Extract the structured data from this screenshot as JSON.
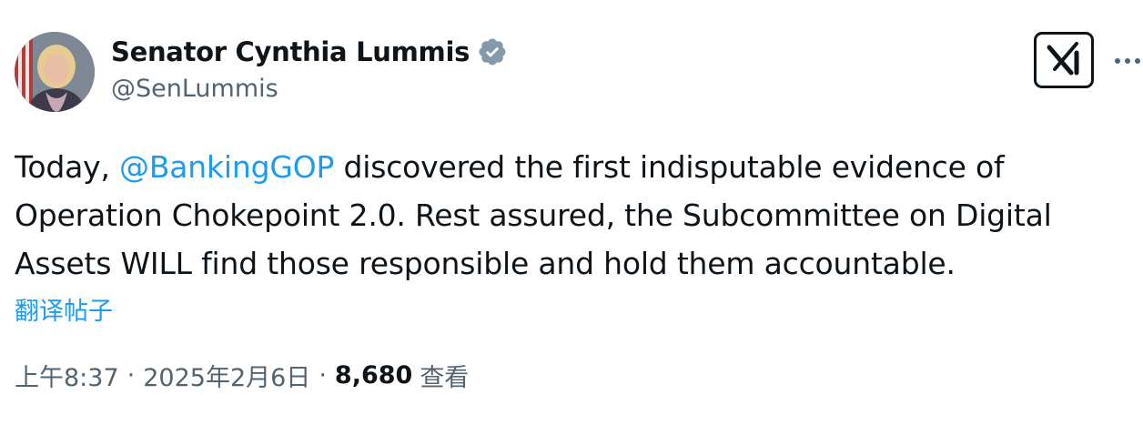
{
  "author": {
    "display_name": "Senator Cynthia Lummis",
    "handle": "@SenLummis",
    "verified_icon": "verified-badge-icon",
    "avatar": "profile-photo"
  },
  "header_actions": {
    "grok_icon": "grok-icon",
    "more_icon": "more-dots-icon"
  },
  "tweet": {
    "text_before": "Today, ",
    "mention": "@BankingGOP",
    "text_after": " discovered the first indisputable evidence of Operation Chokepoint 2.0. Rest assured, the Subcommittee on Digital Assets WILL find those responsible and hold them accountable.",
    "translate_label": "翻译帖子"
  },
  "meta": {
    "time": "上午8:37",
    "separator": "·",
    "date": "2025年2月6日",
    "views_count": "8,680",
    "views_label": "查看"
  },
  "colors": {
    "link": "#1d9bf0",
    "text": "#0f1419",
    "secondary": "#536471",
    "verified": "#829aab"
  }
}
